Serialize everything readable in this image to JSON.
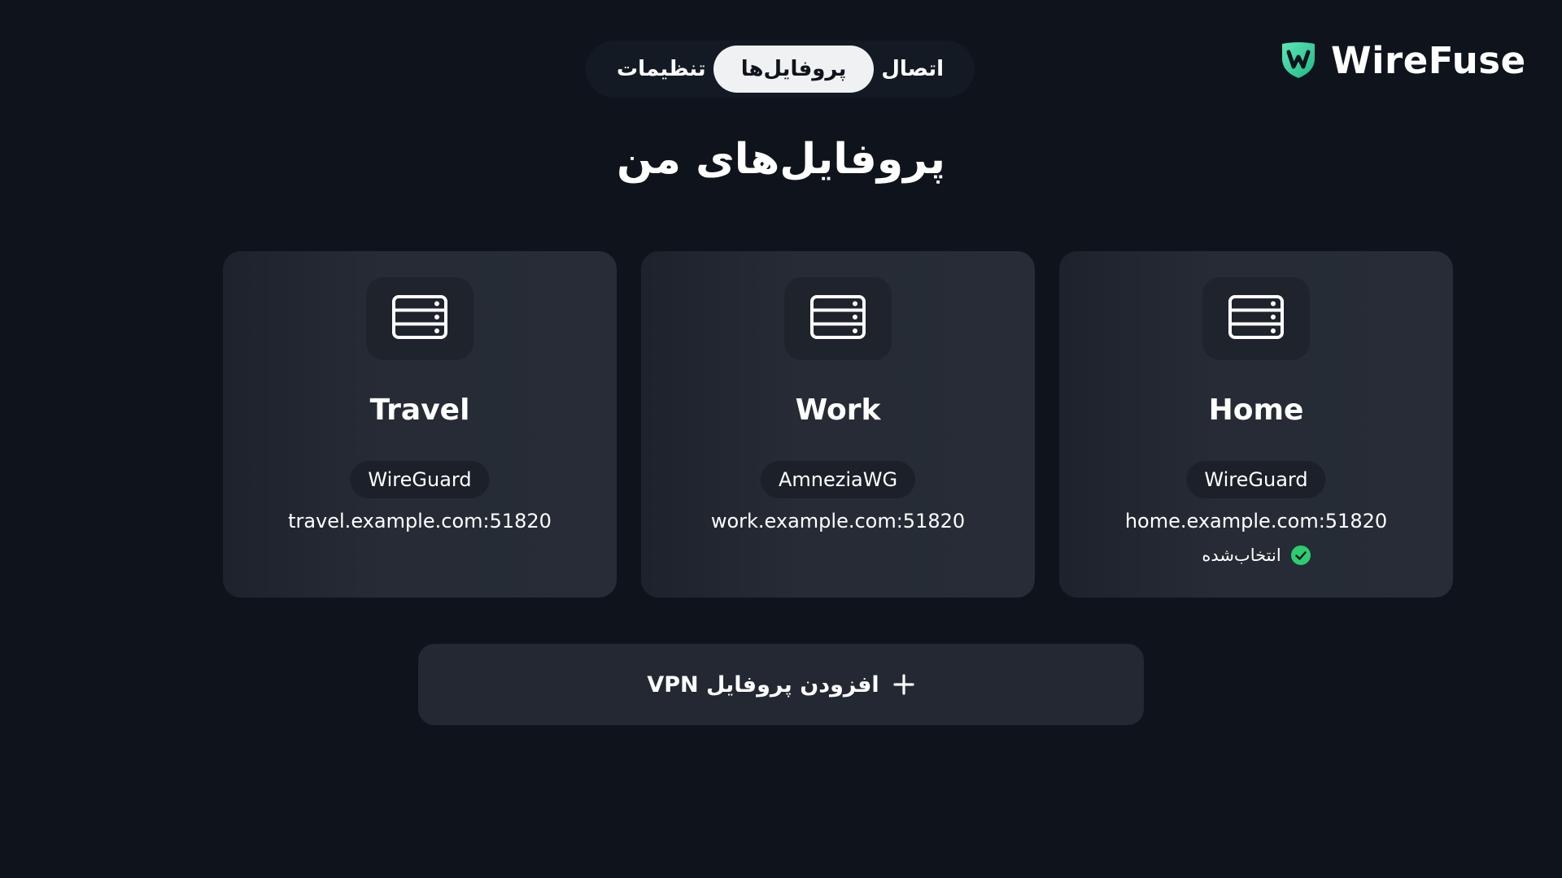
{
  "brand": {
    "name": "WireFuse",
    "logo_icon": "shield-w-icon",
    "accent": "#39d5a1"
  },
  "nav": {
    "tabs": [
      {
        "label": "اتصال",
        "active": false
      },
      {
        "label": "پروفایل‌ها",
        "active": true
      },
      {
        "label": "تنظیمات",
        "active": false
      }
    ]
  },
  "page": {
    "title": "پروفایل‌های من"
  },
  "profiles": [
    {
      "name": "Home",
      "protocol": "WireGuard",
      "endpoint": "home.example.com:51820",
      "selected": true,
      "selected_label": "انتخاب‌شده",
      "icon": "server-icon"
    },
    {
      "name": "Work",
      "protocol": "AmneziaWG",
      "endpoint": "work.example.com:51820",
      "selected": false,
      "icon": "server-icon"
    },
    {
      "name": "Travel",
      "protocol": "WireGuard",
      "endpoint": "travel.example.com:51820",
      "selected": false,
      "icon": "server-icon"
    }
  ],
  "actions": {
    "add_profile_label": "افزودن پروفایل VPN",
    "add_icon": "plus-icon"
  },
  "colors": {
    "background": "#0f141c",
    "card": "#272c36",
    "selected_check": "#2ecc71"
  }
}
